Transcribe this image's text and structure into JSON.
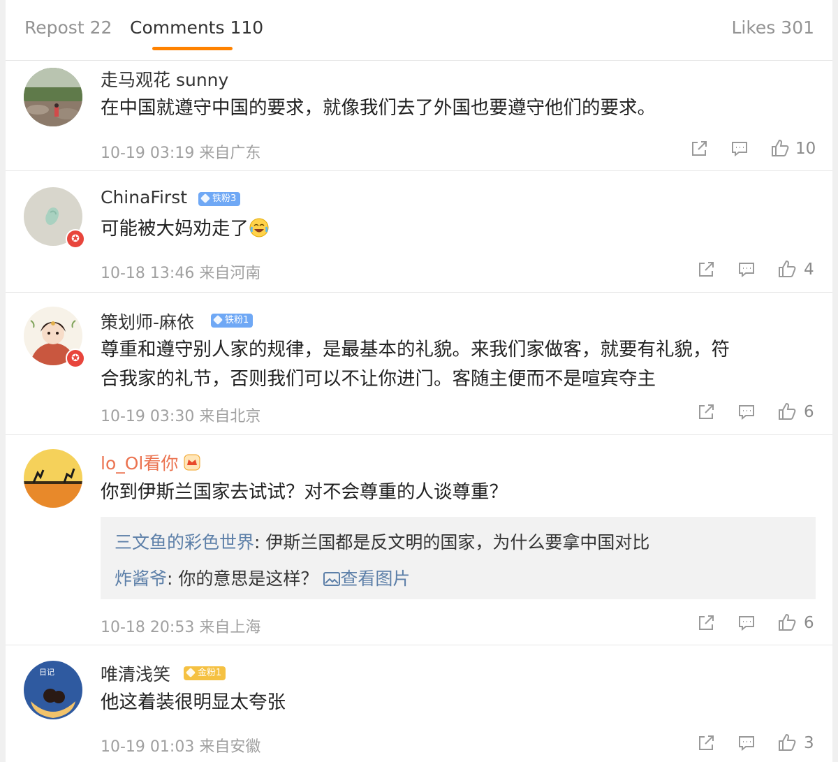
{
  "tabs": {
    "repost": "Repost 22",
    "comments": "Comments 110",
    "likes": "Likes 301"
  },
  "colors": {
    "accent": "#ff8200",
    "link": "#5c7fa8",
    "vip_name": "#eb7350"
  },
  "comments": [
    {
      "user": "走马观花 sunny",
      "text": "在中国就遵守中国的要求，就像我们去了外国也要遵守他们的要求。",
      "time": "10-19 03:19 来自广东",
      "likes": "10"
    },
    {
      "user": "ChinaFirst",
      "badge": "铁粉3",
      "text": "可能被大妈劝走了",
      "emoji": "laugh-cry-icon",
      "time": "10-18 13:46 来自河南",
      "likes": "4"
    },
    {
      "user": "策划师-麻依",
      "badge": "铁粉1",
      "text_line1": "尊重和遵守别人家的规律，是最基本的礼貌。来我们家做客，就要有礼貌，符",
      "text_line2": "合我家的礼节，否则我们可以不让你进门。客随主便而不是喧宾夺主",
      "time": "10-19 03:30 来自北京",
      "likes": "6"
    },
    {
      "user": "lo_Ol看你",
      "text": "你到伊斯兰国家去试试？对不会尊重的人谈尊重？",
      "replies": [
        {
          "user": "三文鱼的彩色世界",
          "text": "伊斯兰国都是反文明的国家，为什么要拿中国对比"
        },
        {
          "user": "炸酱爷",
          "text": "你的意思是这样？",
          "link": "查看图片"
        }
      ],
      "time": "10-18 20:53 来自上海",
      "likes": "6"
    },
    {
      "user": "唯清浅笑",
      "badge": "金粉1",
      "text": "他这着装很明显太夸张",
      "time": "10-19 01:03 来自安徽",
      "likes": "3"
    }
  ]
}
